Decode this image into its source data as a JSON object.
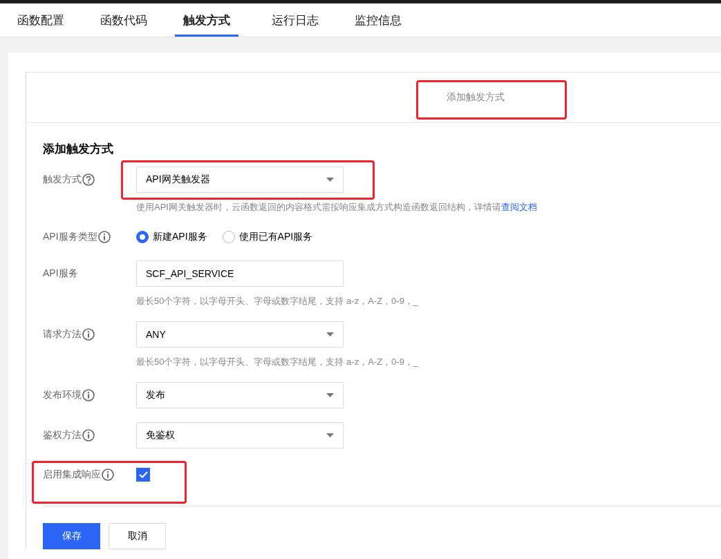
{
  "tabs": [
    {
      "label": "函数配置",
      "selected": false
    },
    {
      "label": "函数代码",
      "selected": false
    },
    {
      "label": "触发方式",
      "selected": true
    },
    {
      "label": "运行日志",
      "selected": false
    },
    {
      "label": "监控信息",
      "selected": false
    }
  ],
  "add_trigger_bar": {
    "label": "添加触发方式"
  },
  "form": {
    "title": "添加触发方式",
    "fields": [
      {
        "kind": "select",
        "label": "触发方式",
        "value": "API网关触发器",
        "hint": "使用API网关触发器时，云函数返回的内容格式需按响应集成方式构造函数返回结构，详情请",
        "hint_link": "查阅文档"
      },
      {
        "kind": "radio",
        "label": "API服务类型",
        "options": [
          {
            "label": "新建API服务",
            "selected": true
          },
          {
            "label": "使用已有API服务",
            "selected": false
          }
        ]
      },
      {
        "kind": "input",
        "label": "API服务",
        "value": "SCF_API_SERVICE",
        "hint": "最长50个字符，以字母开头、字母或数字结尾，支持 a-z，A-Z，0-9，_"
      },
      {
        "kind": "select",
        "label": "请求方法",
        "value": "ANY",
        "hint": "最长50个字符，以字母开头、字母或数字结尾，支持 a-z，A-Z，0-9，_"
      },
      {
        "kind": "select",
        "label": "发布环境",
        "value": "发布"
      },
      {
        "kind": "select",
        "label": "鉴权方法",
        "value": "免鉴权"
      },
      {
        "kind": "checkbox",
        "label": "启用集成响应",
        "checked": true
      }
    ],
    "buttons": [
      {
        "label": "保存",
        "kind": "primary"
      },
      {
        "label": "取消",
        "kind": "default"
      }
    ]
  }
}
